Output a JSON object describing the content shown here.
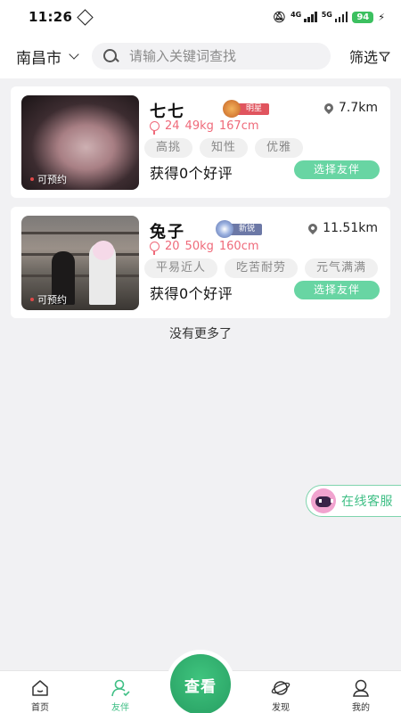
{
  "status_bar": {
    "time": "11:26",
    "net1": "4G",
    "net2": "5G",
    "battery": "94"
  },
  "header": {
    "city": "南昌市",
    "search_placeholder": "请输入关键词查找",
    "filter_label": "筛选"
  },
  "companions": [
    {
      "name": "七七",
      "badge": "明星",
      "badge_color": "#e0545e",
      "distance": "7.7km",
      "age": "24",
      "weight": "49kg",
      "height": "167cm",
      "tags": [
        "高挑",
        "知性",
        "优雅"
      ],
      "availability": "可预约",
      "review": "获得0个好评",
      "action": "选择友伴"
    },
    {
      "name": "兔子",
      "badge": "新锐",
      "badge_color": "#6c78a6",
      "distance": "11.51km",
      "age": "20",
      "weight": "50kg",
      "height": "160cm",
      "tags": [
        "平易近人",
        "吃苦耐劳",
        "元气满满"
      ],
      "availability": "可预约",
      "review": "获得0个好评",
      "action": "选择友伴"
    }
  ],
  "list_end_text": "没有更多了",
  "service_label": "在线客服",
  "bottom_nav": {
    "home": "首页",
    "companion": "友伴",
    "center": "查看",
    "discover": "发现",
    "mine": "我的"
  },
  "colors": {
    "accent": "#3fbf85",
    "button_green": "#68d5a3",
    "meta_pink": "#ef6a7a"
  }
}
